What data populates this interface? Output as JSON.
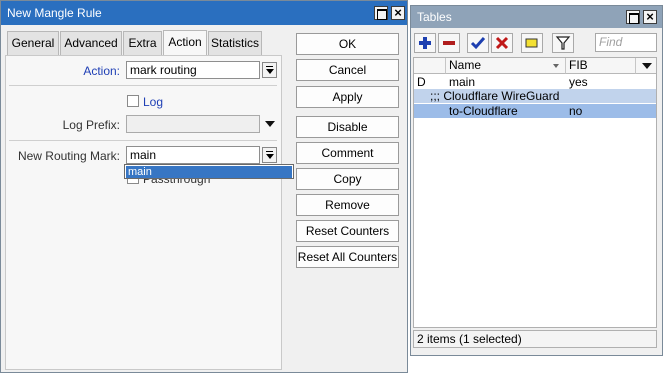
{
  "mangle_window": {
    "title": "New Mangle Rule",
    "tabs": [
      "General",
      "Advanced",
      "Extra",
      "Action",
      "Statistics"
    ],
    "active_tab": "Action",
    "fields": {
      "action_label": "Action:",
      "action_value": "mark routing",
      "log_label": "Log",
      "log_checked": false,
      "log_prefix_label": "Log Prefix:",
      "log_prefix_value": "",
      "routing_mark_label": "New Routing Mark:",
      "routing_mark_value": "main",
      "passthrough_label": "Passthrough"
    },
    "dropdown_open": {
      "options": [
        "main"
      ],
      "highlighted": "main"
    },
    "buttons": [
      "OK",
      "Cancel",
      "Apply",
      "Disable",
      "Comment",
      "Copy",
      "Remove",
      "Reset Counters",
      "Reset All Counters"
    ]
  },
  "tables_window": {
    "title": "Tables",
    "toolbar": {
      "icons": [
        "add-icon",
        "remove-icon",
        "enable-icon",
        "disable-icon",
        "comment-icon",
        "filter-icon"
      ],
      "find_placeholder": "Find"
    },
    "columns": [
      "",
      "Name",
      "FIB"
    ],
    "rows": [
      {
        "flag": "D",
        "name": "main",
        "fib": "yes",
        "type": "row"
      },
      {
        "flag": "",
        "name": ";;; Cloudflare WireGuard",
        "fib": "",
        "type": "group"
      },
      {
        "flag": "",
        "name": "to-Cloudflare",
        "fib": "no",
        "type": "selected"
      }
    ],
    "status": "2 items (1 selected)"
  },
  "colors": {
    "active_titlebar": "#2a6fbf",
    "inactive_titlebar": "#8fa3b8",
    "selection": "#9cbce8",
    "label_blue": "#1f3fb5"
  }
}
